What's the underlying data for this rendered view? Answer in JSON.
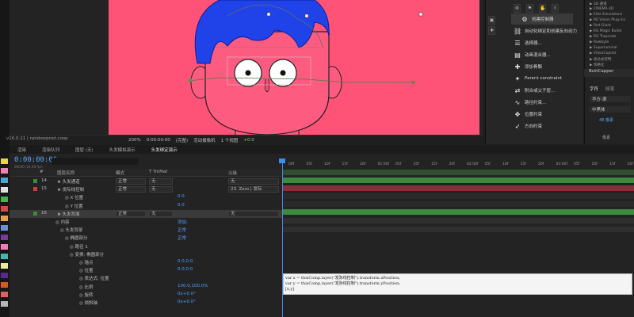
{
  "colors": {
    "canvas_bg": "#fe5377",
    "hair": "#1f43e8",
    "skin": "#fe5b80",
    "timecode": "#57a6ff",
    "track_green": "#3d8a3d",
    "track_red": "#8a2f35",
    "cti": "#3d8bf0"
  },
  "left_strip_colors": [
    "#e8d44d",
    "#ee81b6",
    "#4aa3d6",
    "#e1e1e1",
    "#3ab84c",
    "#d14a4a",
    "#e8a14b",
    "#6b8ed6",
    "#7a3a9a",
    "#f07bb8",
    "#3fb7a9",
    "#e9e9a0",
    "#5a2a8a",
    "#d65b1e",
    "#e06060",
    "#b7b7b7"
  ],
  "viewer": {
    "zoom": "200%",
    "timecode": "0:00:00:00",
    "resolution": "(完整)",
    "camera": "活动摄像机",
    "views": "1 个视图",
    "offset": "+0.0"
  },
  "plugin": {
    "items": [
      {
        "icon": "gear-icon",
        "label": "创建控制器"
      },
      {
        "icon": "link-icon",
        "label": "自动化绑定和创建反向动力"
      },
      {
        "icon": "select-icon",
        "label": "选择器..."
      },
      {
        "icon": "blend-icon",
        "label": "动画混合器..."
      },
      {
        "icon": "bone-icon",
        "label": "添加骨骼"
      },
      {
        "icon": "pin-icon",
        "label": "Parent constraint"
      },
      {
        "icon": "parent-icon",
        "label": "附合或父子层..."
      },
      {
        "icon": "path-icon",
        "label": "路径约束..."
      },
      {
        "icon": "position-icon",
        "label": "位置约束"
      },
      {
        "icon": "direction-icon",
        "label": "方向约束"
      }
    ],
    "version": "v16.0.11 | rainboxprod.coop"
  },
  "effects_list": [
    "3D 通道",
    "CINEMA 4D",
    "Elite Emulations",
    "RE:Vision Plug-ins",
    "Red Giant",
    "RG Magic Bullet",
    "RG Trapcode",
    "Rowbyte",
    "Superluminal",
    "VideoCopilot",
    "表达式控制",
    "风格化"
  ],
  "char_panel": {
    "header": "ButtCapper",
    "tab1": "字符",
    "tab2": "段落",
    "font": "华方-隶",
    "style": "中黑体",
    "unit": "像素",
    "size_label": "48 像素"
  },
  "timeline": {
    "tabs": [
      "渲染",
      "渲染队列",
      "图层 (无)",
      "头发模拟演示",
      "头发绑定演示"
    ],
    "active_tab_index": 4,
    "timecode": "0:00:00:00",
    "timecode_sub": "00000 (24.00 fps)",
    "col_headers": {
      "num": "#",
      "name": "图层名称",
      "mode": "模式",
      "trkmat": "T TrkMat",
      "parent": "父级"
    },
    "layers": [
      {
        "num": "14",
        "name": "头发通道",
        "mode": "正常",
        "trk": "无",
        "parent": "无"
      },
      {
        "num": "15",
        "name": "发际线控制",
        "mode": "正常",
        "trk": "无",
        "parent": "23. Zero | 发际",
        "color": "#d23a3a"
      },
      {
        "prop": "X 位置",
        "value": "0.0"
      },
      {
        "prop": "Y 位置",
        "value": "0.0"
      },
      {
        "num": "16",
        "name": "头发背面",
        "mode": "正常",
        "trk": "无",
        "parent": "无",
        "selected": true
      },
      {
        "prop": "内容",
        "value": "添加:"
      },
      {
        "prop": "头发背部",
        "value": "正常"
      },
      {
        "prop": "椭圆部分",
        "value": "正常"
      },
      {
        "prop": "路径 1"
      },
      {
        "prop": "变换: 椭圆部分"
      },
      {
        "prop": "锚点",
        "value": "0.0,0.0"
      },
      {
        "prop": "位置",
        "value": "0.0,0.0"
      },
      {
        "prop": "表达式: 位置"
      },
      {
        "prop": "比例",
        "value": "100.0,100.0%"
      },
      {
        "prop": "旋转",
        "value": "0x+0.0°"
      },
      {
        "prop": "倾斜轴",
        "value": "0x+0.0°"
      }
    ],
    "ruler_ticks": [
      "00f",
      "05f",
      "10f",
      "15f",
      "20f",
      "01:00f",
      "05f",
      "10f",
      "15f",
      "20f",
      "02:00f",
      "05f",
      "10f",
      "15f",
      "20f",
      "03:00f",
      "05f",
      "10f",
      "15f",
      "20f"
    ],
    "expression": [
      "var x = thisComp.layer(\"发际线控制\").transform.xPosition;",
      "var y = thisComp.layer(\"发际线控制\").transform.yPosition;",
      "[x,y]"
    ]
  }
}
